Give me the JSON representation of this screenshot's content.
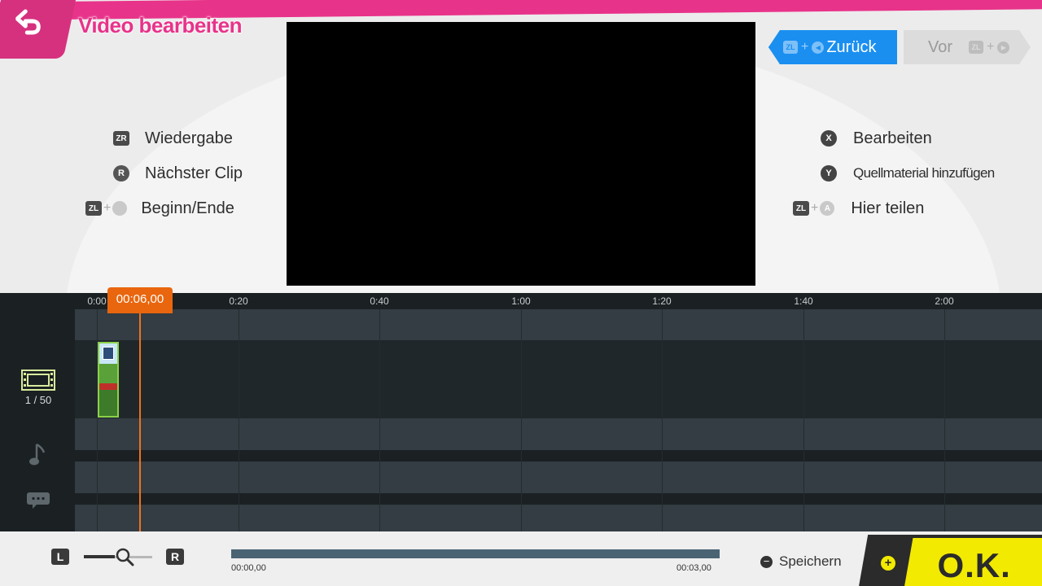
{
  "header": {
    "title": "Video bearbeiten",
    "back_icon": "undo-arrow-icon"
  },
  "hints_left": [
    {
      "buttons": "ZR",
      "label": "Wiedergabe"
    },
    {
      "buttons": "R",
      "label": "Nächster Clip"
    },
    {
      "buttons": "ZL",
      "label": "Beginn/Ende"
    }
  ],
  "hints_right": [
    {
      "buttons": "X",
      "label": "Bearbeiten"
    },
    {
      "buttons": "Y",
      "label": "Quellmaterial hinzufügen"
    },
    {
      "buttons": "ZL",
      "extra": "A",
      "label": "Hier teilen"
    }
  ],
  "nav": {
    "back": {
      "button": "ZL",
      "label": "Zurück"
    },
    "forward": {
      "button": "ZL",
      "label": "Vor"
    }
  },
  "timeline": {
    "ruler": [
      "0:00",
      "0:20",
      "0:40",
      "1:00",
      "1:20",
      "1:40",
      "2:00"
    ],
    "playhead_time": "00:06,00",
    "clip_count": "1 / 50",
    "track_icons": [
      "film-strip-icon",
      "music-note-icon",
      "speech-bubble-icon"
    ]
  },
  "bottom": {
    "zoom_left_key": "L",
    "zoom_right_key": "R",
    "progress_start": "00:00,00",
    "progress_end": "00:03,00",
    "save_label": "Speichern",
    "ok_label": "O.K."
  },
  "colors": {
    "accent_pink": "#e8338a",
    "nav_blue": "#1a8ff0",
    "playhead_orange": "#e9660e",
    "ok_yellow": "#f2ea00"
  }
}
